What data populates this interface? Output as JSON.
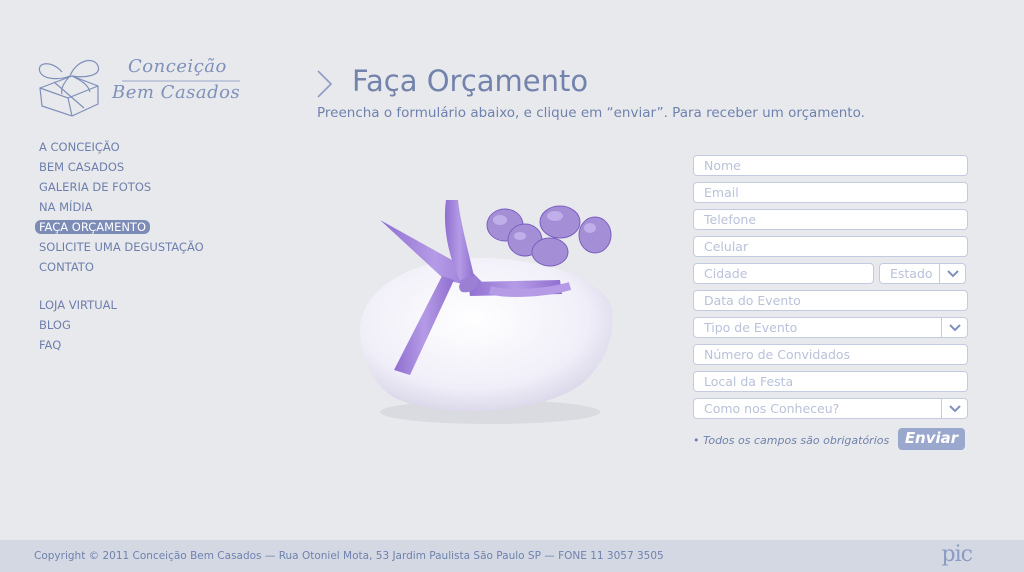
{
  "brand": {
    "line1": "Conceição",
    "line2": "Bem Casados"
  },
  "nav": {
    "items": [
      {
        "label": "A CONCEIÇÃO"
      },
      {
        "label": "BEM CASADOS"
      },
      {
        "label": "GALERIA DE FOTOS"
      },
      {
        "label": "NA MÍDIA"
      },
      {
        "label": "FAÇA ORÇAMENTO",
        "active": true
      },
      {
        "label": "SOLICITE UMA DEGUSTAÇÃO"
      },
      {
        "label": "CONTATO"
      }
    ],
    "secondary": [
      {
        "label": "LOJA VIRTUAL"
      },
      {
        "label": "BLOG"
      },
      {
        "label": "FAQ"
      }
    ]
  },
  "page": {
    "title": "Faça Orçamento",
    "subtitle": "Preencha o formulário abaixo, e clique em “enviar”. Para receber um orçamento."
  },
  "form": {
    "nome": "Nome",
    "email": "Email",
    "telefone": "Telefone",
    "celular": "Celular",
    "cidade": "Cidade",
    "estado": "Estado",
    "data_evento": "Data do Evento",
    "tipo_evento": "Tipo de Evento",
    "num_convidados": "Número de Convidados",
    "local_festa": "Local da Festa",
    "como_conheceu": "Como nos Conheceu?",
    "required_note": "• Todos os campos são obrigatórios",
    "submit_label": "Enviar"
  },
  "footer": {
    "text": "Copyright © 2011 Conceição Bem Casados  — Rua Otoniel Mota, 53 Jardim Paulista São Paulo SP — FONE 11 3057 3505",
    "logo": "pic"
  },
  "colors": {
    "background": "#e8e9ec",
    "accent": "#7383ad",
    "button": "#9aa8cd",
    "product_ribbon": "#a48fd6"
  }
}
